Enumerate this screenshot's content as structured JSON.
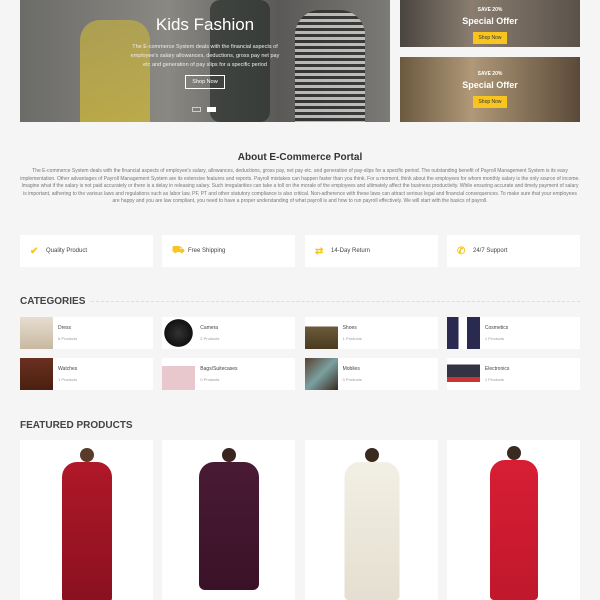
{
  "hero": {
    "title": "Kids Fashion",
    "text": "The E-commerce System deals with the financial aspects of employee's salary allowances, deductions, gross pay net pay etc and generation of pay slips for a specific period",
    "button": "Shop Now"
  },
  "offers": [
    {
      "save": "SAVE 20%",
      "title": "Special Offer",
      "button": "Shop Now"
    },
    {
      "save": "SAVE 20%",
      "title": "Special Offer",
      "button": "Shop Now"
    }
  ],
  "about": {
    "title": "About E-Commerce Portal",
    "text": "The E-commerce System deals with the financial aspects of employee's salary, allowances, deductions, gross pay, net pay etc. and generation of pay-slips for a specific period. The outstanding benefit of Payroll Management System is its easy implementation. Other advantages of Payroll Management System are its extensive features and reports. Payroll mistakes can happen faster than you think. For a moment, think about the employees for whom monthly salary is the only source of income. Imagine what if the salary is not paid accurately or there is a delay in releasing salary. Such irregularities can take a toll on the morale of the employees and ultimately affect the business productivity. While ensuring accurate and timely payment of salary is important, adhering to the various laws and regulations such as labor law, PF, PT and other statutory compliance is also critical. Non-adherence with these laws can attract serious legal and financial consequences. To make sure that your employees are happy and you are law compliant, you need to have a proper understanding of what payroll is and how to run payroll effectively. We will start with the basics of payroll."
  },
  "features": [
    {
      "icon": "check-icon",
      "label": "Quality Product"
    },
    {
      "icon": "truck-icon",
      "label": "Free Shipping"
    },
    {
      "icon": "exchange-icon",
      "label": "14-Day Return"
    },
    {
      "icon": "phone-icon",
      "label": "24/7 Support"
    }
  ],
  "categories_title": "CATEGORIES",
  "categories": [
    {
      "name": "Dress",
      "count": "6 Products"
    },
    {
      "name": "Camera",
      "count": "2 Products"
    },
    {
      "name": "Shoes",
      "count": "1 Products"
    },
    {
      "name": "Cosmetics",
      "count": "1 Products"
    },
    {
      "name": "Watches",
      "count": "1 Products"
    },
    {
      "name": "Bags/Suitecases",
      "count": "0 Products"
    },
    {
      "name": "Mobiles",
      "count": "0 Products"
    },
    {
      "name": "Electronics",
      "count": "1 Products"
    }
  ],
  "featured_title": "FEATURED PRODUCTS",
  "colors": {
    "accent": "#f7c51e"
  }
}
